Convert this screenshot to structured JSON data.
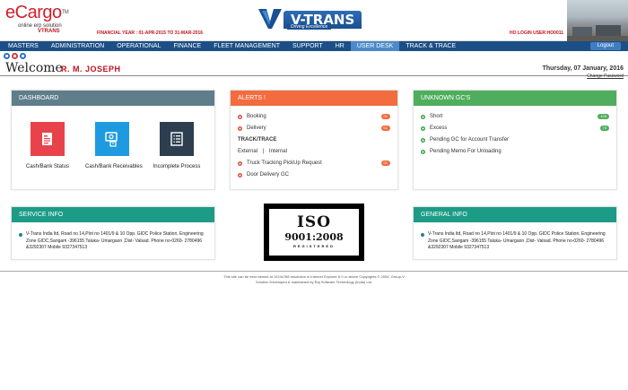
{
  "header": {
    "logo_text": "eCargo",
    "logo_tm": "TM",
    "tagline": "online erp solution",
    "sub": "VTRANS",
    "financial_year": "FINANCIAL YEAR : 01-APR-2015 TO 31-MAR-2016",
    "center_logo": "V-TRANS",
    "center_tagline": "Driving Excellence",
    "login": "HO LOGIN USER:HO0011"
  },
  "nav": {
    "items": [
      "MASTERS",
      "ADMINISTRATION",
      "OPERATIONAL",
      "FINANCE",
      "FLEET MANAGEMENT",
      "SUPPORT",
      "HR",
      "USER DESK",
      "TRACK & TRACE"
    ],
    "active": "USER DESK",
    "logout": "Logout"
  },
  "welcome": {
    "label": "Welcome",
    "name": "R. M. JOSEPH",
    "date": "Thursday, 07 January, 2016",
    "change_password": "Change Password"
  },
  "dashboard": {
    "title": "DASHBOARD",
    "tiles": [
      {
        "label": "Cash/Bank Status",
        "color": "#e8434a",
        "icon": "document-icon"
      },
      {
        "label": "Cash/Bank Receivables",
        "color": "#1e9be0",
        "icon": "receivables-icon"
      },
      {
        "label": "Incomplete Process",
        "color": "#2c3e50",
        "icon": "list-icon"
      }
    ]
  },
  "alerts": {
    "title": "ALERTS !",
    "booking": {
      "label": "Booking",
      "count": "01"
    },
    "delivery": {
      "label": "Delivery",
      "count": "01"
    },
    "track_heading": "TRACK/TRACE",
    "external": "External",
    "separator": "|",
    "internal": "Internal",
    "truck_tracking": {
      "label": "Truck Tracking PickUp Request",
      "count": "01"
    },
    "door_delivery": {
      "label": "Door Delivery GC"
    }
  },
  "unknown": {
    "title": "UNKNOWN GC'S",
    "short": {
      "label": "Short",
      "count": "103"
    },
    "excess": {
      "label": "Excess",
      "count": "75"
    },
    "pending_transfer": {
      "label": "Pending GC for Account Transfer"
    },
    "pending_memo": {
      "label": "Pending Memo For Unloading"
    }
  },
  "service_info": {
    "title": "SERVICE INFO",
    "text": "V-Trans India ltd, Road no 14,Plot no 1401/9 & 10 Opp. GIDC Police Station, Engineering Zone GIDC,Sarigam -396155 Taluka- Umargaon ,Dist- Valsad. Phone no-0260- 2780496 &3292307 Mobile 9327347513"
  },
  "general_info": {
    "title": "GENERAL INFO",
    "text": "V-Trans India ltd, Road no 14,Plot no 1401/9 & 10 Opp. GIDC Police Station, Engineering Zone GIDC,Sarigam -396155 Taluka- Umargaon ,Dist- Valsad. Phone no-0260- 2780496 &3292307 Mobile 9327347513"
  },
  "iso": {
    "line1": "ISO",
    "line2": "9001:2008",
    "line3": "REGISTERED"
  },
  "footer": {
    "line1": "This site can be best viewed at 1024x768 resolution in Internet Explorer 6.0 or above Copyrights © 2004, Group-V",
    "line2": "Solution Developed & maintained by Raj Software Technology (India) Ltd."
  },
  "colors": {
    "nav_bg": "#1b4f86",
    "nav_active": "#4a8ac9",
    "alerts": "#f26c3f",
    "dashboard": "#607d8b",
    "unknown": "#4fae5e",
    "info": "#1c9c86",
    "brand_red": "#c0141e"
  }
}
